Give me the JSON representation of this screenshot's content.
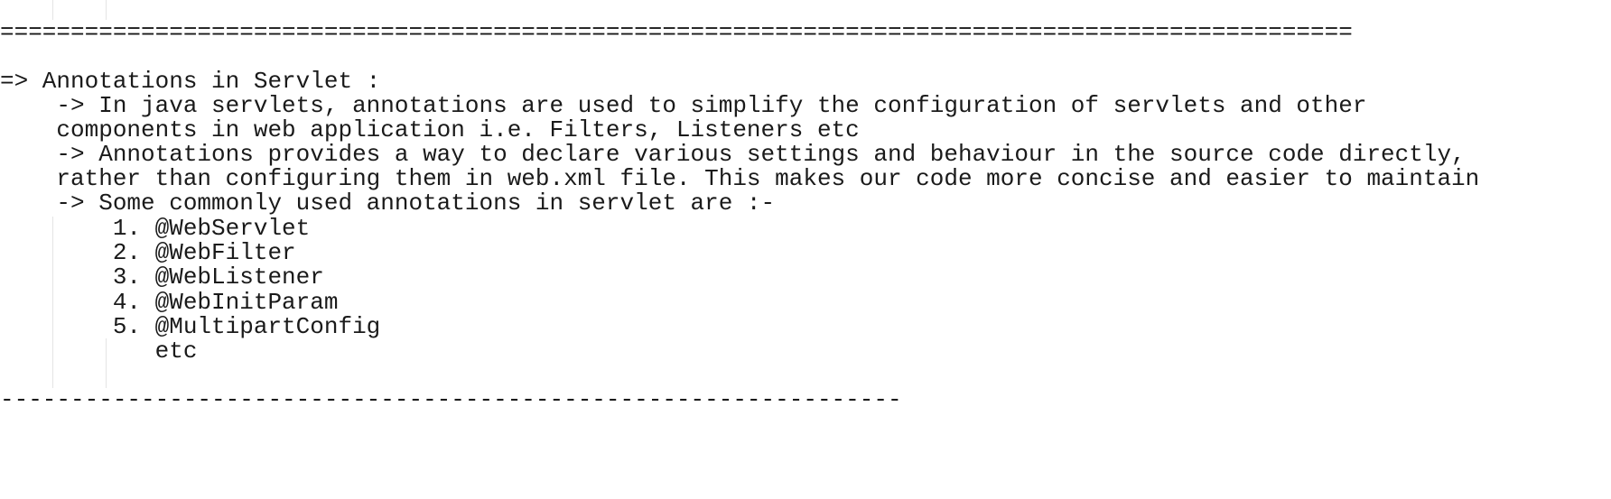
{
  "document": {
    "lines": [
      "================================================================================================",
      "",
      "=> Annotations in Servlet :",
      "    -> In java servlets, annotations are used to simplify the configuration of servlets and other",
      "    components in web application i.e. Filters, Listeners etc",
      "    -> Annotations provides a way to declare various settings and behaviour in the source code directly,",
      "    rather than configuring them in web.xml file. This makes our code more concise and easier to maintain",
      "    -> Some commonly used annotations in servlet are :-",
      "        1. @WebServlet",
      "        2. @WebFilter",
      "        3. @WebListener",
      "        4. @WebInitParam",
      "        5. @MultipartConfig",
      "           etc",
      "",
      "----------------------------------------------------------------"
    ]
  }
}
